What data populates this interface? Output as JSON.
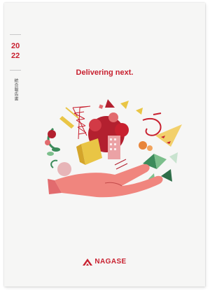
{
  "cover": {
    "year_line1": "20",
    "year_line2": "22",
    "report_type": "統合報告書",
    "tagline": "Delivering next.",
    "brand": "NAGASE",
    "logo_icon": "nagase-mountain-logo",
    "accent_color": "#c8202f"
  }
}
